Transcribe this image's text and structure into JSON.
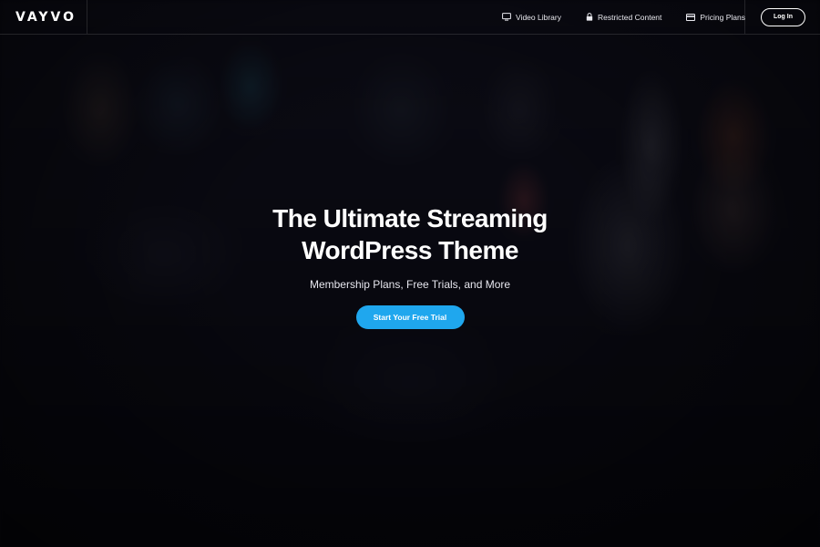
{
  "brand": {
    "logo_text": "VAYVO"
  },
  "nav": {
    "items": [
      {
        "label": "Video Library",
        "icon": "monitor-icon"
      },
      {
        "label": "Restricted Content",
        "icon": "lock-icon"
      },
      {
        "label": "Pricing Plans",
        "icon": "credit-card-icon"
      }
    ],
    "login_label": "Log In"
  },
  "hero": {
    "title_line1": "The Ultimate Streaming",
    "title_line2": "WordPress Theme",
    "subtitle": "Membership Plans, Free Trials, and More",
    "cta_label": "Start Your Free Trial"
  },
  "colors": {
    "background": "#07070f",
    "accent": "#1fa7ee",
    "text": "#ffffff"
  }
}
